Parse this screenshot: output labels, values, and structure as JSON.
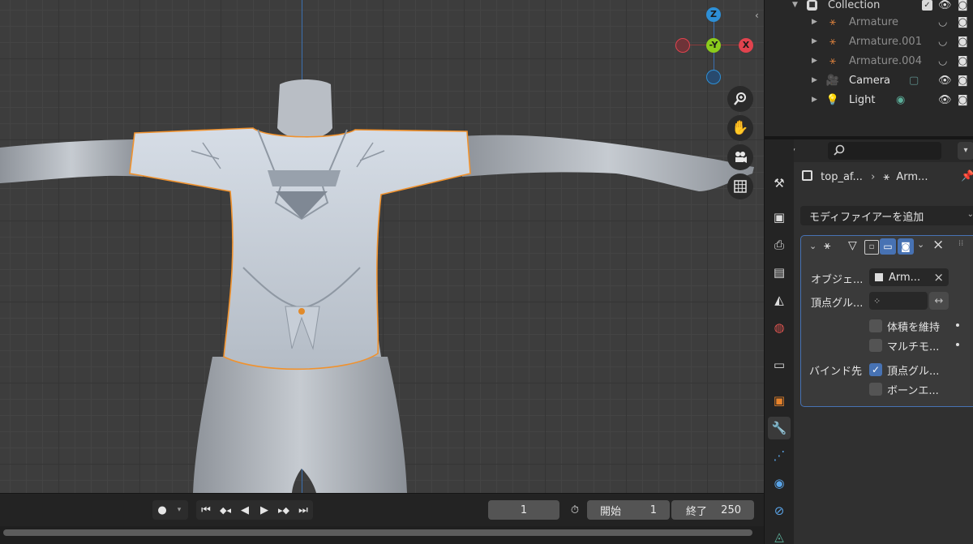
{
  "outliner": {
    "collection_label": "Collection",
    "items": [
      {
        "label": "Armature",
        "icon": "armature-icon",
        "disabled": true
      },
      {
        "label": "Armature.001",
        "icon": "armature-icon",
        "disabled": true
      },
      {
        "label": "Armature.004",
        "icon": "armature-icon",
        "disabled": true
      },
      {
        "label": "Camera",
        "icon": "camera-object-icon",
        "disabled": false
      },
      {
        "label": "Light",
        "icon": "light-object-icon",
        "disabled": false
      }
    ]
  },
  "gizmo": {
    "z": "Z",
    "y": "-Y",
    "x": "X"
  },
  "properties": {
    "context_object": "top_af...",
    "context_modifier": "Arm...",
    "add_modifier": "モディファイアーを追加",
    "modifier": {
      "object_label": "オブジェ...",
      "object_value": "Arm...",
      "vertex_group_label": "頂点グル...",
      "preserve_volume_label": "体積を維持",
      "multi_modifier_label": "マルチモ...",
      "bind_to_label": "バインド先",
      "bind_vertex_groups_label": "頂点グル...",
      "bind_bone_envelopes_label": "ボーンエ...",
      "bind_vertex_groups_checked": true
    }
  },
  "timeline": {
    "current_frame": "1",
    "start_label": "開始",
    "start_value": "1",
    "end_label": "終了",
    "end_value": "250"
  },
  "colors": {
    "accent": "#4772b3",
    "selection_outline": "#f0922e",
    "gizmo_x": "#e1434e",
    "gizmo_y": "#8bcc1c",
    "gizmo_z": "#2d8fd6"
  }
}
